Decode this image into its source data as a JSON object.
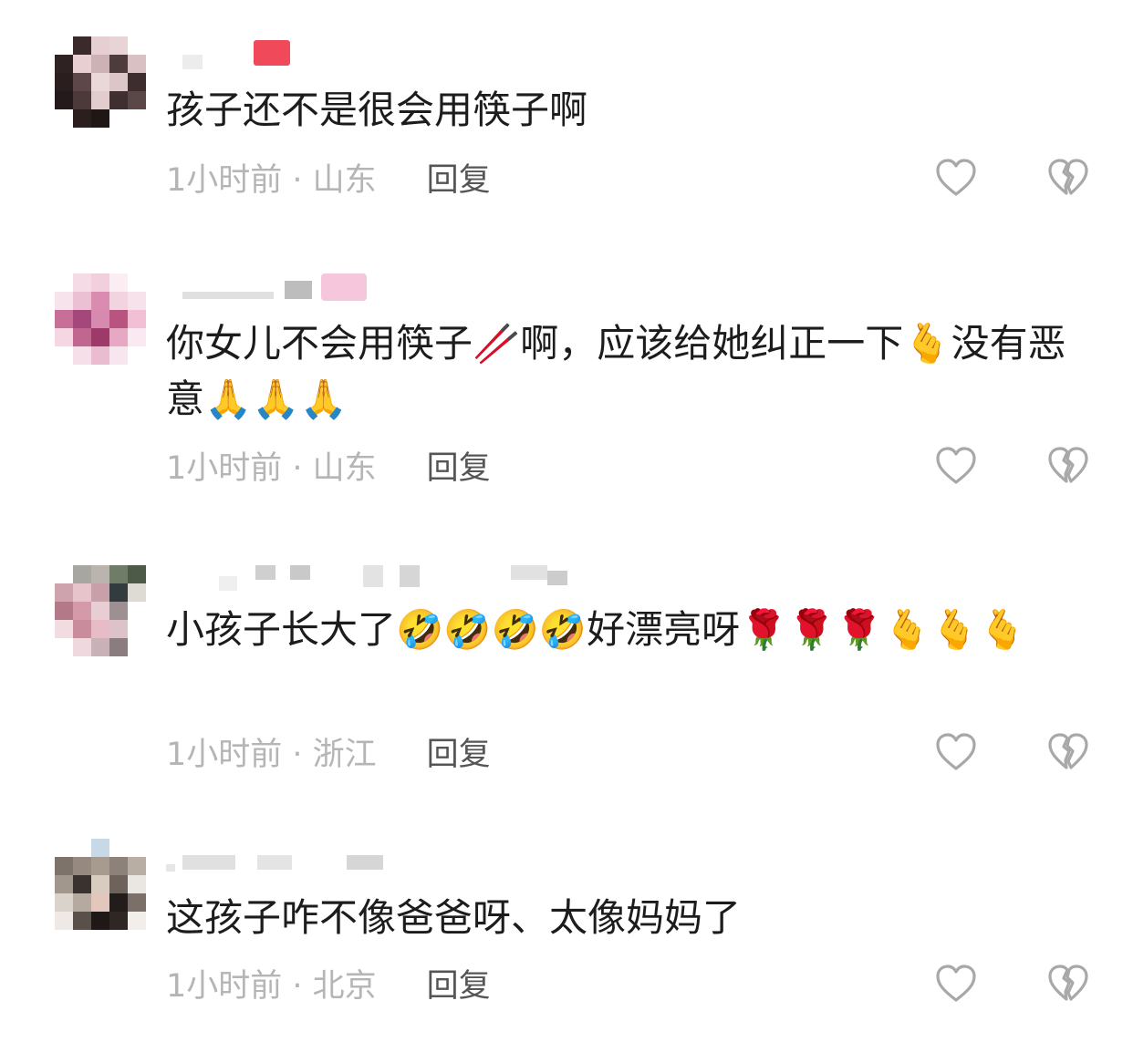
{
  "comments": [
    {
      "text": "孩子还不是很会用筷子啊",
      "time_location": "1小时前 · 山东",
      "reply_label": "回复",
      "name_emoji": "🌹",
      "avatar_colors": [
        "#2b1e1e",
        "#e2c9cb",
        "#5a4545",
        "#d9c0c3"
      ]
    },
    {
      "text": "你女儿不会用筷子🥢啊，应该给她纠正一下🫰没有恶意🙏🙏🙏",
      "time_location": "1小时前 · 山东",
      "reply_label": "回复",
      "name_emoji": "🎀",
      "avatar_colors": [
        "#f3dbe5",
        "#c86e97",
        "#e9b0c8",
        "#9a3c68"
      ]
    },
    {
      "text": "小孩子长大了🤣🤣🤣🤣好漂亮呀🌹🌹🌹🫰🫰🫰",
      "time_location": "1小时前 · 浙江",
      "reply_label": "回复",
      "avatar_colors": [
        "#a7a7a2",
        "#d7aeb6",
        "#5d6a58",
        "#eed4da"
      ]
    },
    {
      "text": "这孩子咋不像爸爸呀、太像妈妈了",
      "time_location": "1小时前 · 北京",
      "reply_label": "回复",
      "avatar_colors": [
        "#8f857c",
        "#2a2320",
        "#d9d3cc",
        "#6c625a"
      ]
    }
  ],
  "icons": {
    "like": "heart-outline-icon",
    "dislike": "broken-heart-icon"
  }
}
